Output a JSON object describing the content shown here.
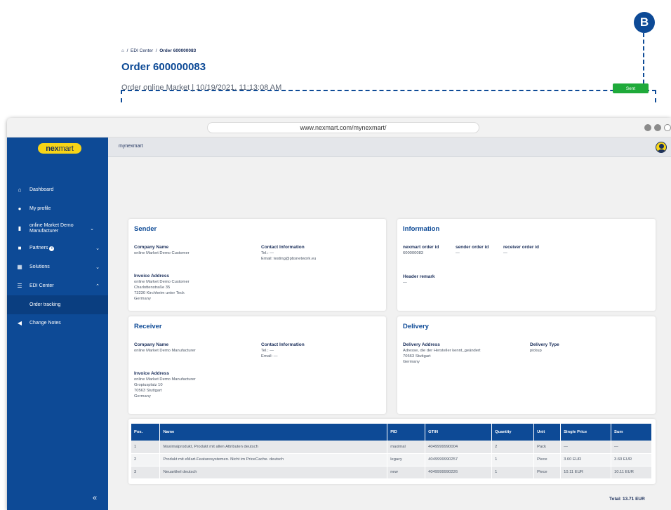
{
  "annotation": {
    "badge": "B"
  },
  "browser": {
    "url": "www.nexmart.com/mynexmart/"
  },
  "sidebar": {
    "logo_prefix": "nex",
    "logo_suffix": "mart",
    "items": [
      {
        "label": "Dashboard",
        "icon": "home-icon"
      },
      {
        "label": "My profile",
        "icon": "user-icon"
      },
      {
        "label": "online Market Demo Manufacturer",
        "icon": "building-icon"
      },
      {
        "label": "Partners",
        "icon": "briefcase-icon"
      },
      {
        "label": "Solutions",
        "icon": "grid-icon"
      },
      {
        "label": "EDI Center",
        "icon": "list-icon"
      },
      {
        "label": "Order tracking",
        "icon": ""
      },
      {
        "label": "Change Notes",
        "icon": "megaphone-icon"
      }
    ],
    "info_glyph": "i",
    "collapse_glyph": "«"
  },
  "topbar": {
    "title": "mynexmart"
  },
  "breadcrumb": {
    "home": "⌂",
    "sep": "/",
    "edi": "EDI Center",
    "current": "Order 600000083"
  },
  "page": {
    "title": "Order 600000083",
    "subtitle": "Order online Market | 10/19/2021, 11:13:08 AM",
    "status": "Sent"
  },
  "sender": {
    "title": "Sender",
    "company_label": "Company Name",
    "company_value": "online Market Demo Customer",
    "contact_label": "Contact Information",
    "contact_value": "Tel.: —\nEmail: testing@pbsnetwork.eu",
    "invoice_label": "Invoice Address",
    "invoice_value": "online Market Demo Customer\nCharlottenstraße 35\n73230 Kirchheim unter Teck\nGermany"
  },
  "information": {
    "title": "Information",
    "order_id_label": "nexmart order id",
    "order_id_value": "600000083",
    "sender_id_label": "sender order id",
    "sender_id_value": "—",
    "receiver_id_label": "receiver order id",
    "receiver_id_value": "—",
    "remark_label": "Header remark",
    "remark_value": "—"
  },
  "receiver": {
    "title": "Receiver",
    "company_label": "Company Name",
    "company_value": "online Market Demo Manufacturer",
    "contact_label": "Contact Information",
    "contact_value": "Tel.: —\nEmail: —",
    "invoice_label": "Invoice Address",
    "invoice_value": "online Market Demo Manufacturer\nGropiusplatz 10\n70563 Stuttgart\nGermany"
  },
  "delivery": {
    "title": "Delivery",
    "address_label": "Delivery Address",
    "address_value": "Adresse, die der Hersteller kennt_geändert\n70563 Stuttgart\nGermany",
    "type_label": "Delivery Type",
    "type_value": "pickup"
  },
  "table": {
    "headers": [
      "Pos.",
      "Name",
      "PID",
      "GTIN",
      "Quantity",
      "Unit",
      "Single Price",
      "Sum"
    ],
    "rows": [
      [
        "1",
        "Maximalprodukt, Produkt mit allen Attributen deutsch",
        "maximal",
        "4049999990004",
        "2",
        "Pack",
        "—",
        "—"
      ],
      [
        "2",
        "Produkt mit eMart-Featuresystemen. Nicht im PriceCache. deutsch",
        "legacy",
        "4049999990257",
        "1",
        "Piece",
        "3.60 EUR",
        "3.60 EUR"
      ],
      [
        "3",
        "Neuartikel deutsch",
        "new",
        "4049999990226",
        "1",
        "Piece",
        "10.11 EUR",
        "10.11 EUR"
      ]
    ]
  },
  "total": "Total: 13.71 EUR",
  "colors": {
    "primary": "#0d4a96",
    "accent": "#f7d417",
    "success": "#1faa3a"
  }
}
